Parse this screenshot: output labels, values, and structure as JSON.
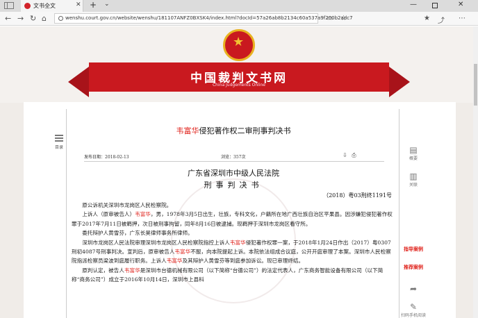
{
  "browser": {
    "tab_title": "文书全文",
    "tab_close": "✕",
    "new_tab": "+",
    "tab_menu": "⌄",
    "minimize": "—",
    "close": "✕",
    "url": "wenshu.court.gov.cn/website/wenshu/181107ANFZ0BXSK4/index.html?docId=57a26ab8b2134c60a537a9f200b2adc7",
    "back": "←",
    "forward": "→",
    "refresh": "↻",
    "home": "⌂",
    "icons": [
      "reading-mode-icon",
      "favorite-icon",
      "favorites-list-icon",
      "share-icon"
    ]
  },
  "site": {
    "title": "中国裁判文书网",
    "subtitle": "China Judgements Online",
    "emblem_color": "#c9191f"
  },
  "toc": {
    "label": "目录"
  },
  "document": {
    "title_name": "韦富华",
    "title_rest": "侵犯著作权二审刑事判决书",
    "publish_label": "发布日期：2018-02-13",
    "views_label": "浏览：357次",
    "court": "广东省深圳市中级人民法院",
    "doc_type": "刑事判决书",
    "case_no": "（2018）粤03刑终1191号",
    "paragraphs": [
      [
        {
          "t": "原公诉机关深圳市龙岗区人民检察院。"
        }
      ],
      [
        {
          "t": "上诉人（原审被告人）"
        },
        {
          "t": "韦富华",
          "red": true
        },
        {
          "t": "，男，1978年3月5日出生，壮族，专科文化，户籍所在地广西壮族自治区平果县。因涉嫌犯侵犯著作权罪于2017年7月11日被羁押，次日被刑事拘留，同年8月16日被逮捕。现羁押于深圳市龙岗区看守所。"
        }
      ],
      [
        {
          "t": "委托辩护人黄雪芬，广东长昊律师事务所律师。"
        }
      ],
      [
        {
          "t": "深圳市龙岗区人民法院审理深圳市龙岗区人民检察院指控上诉人"
        },
        {
          "t": "韦富华",
          "red": true
        },
        {
          "t": "侵犯著作权罪一案，于2018年1月24日作出（2017）粤0307刑初4087号刑事判决。宣判后，原审被告人"
        },
        {
          "t": "韦富华",
          "red": true
        },
        {
          "t": "不服，向本院提起上诉。本院依法组成合议庭，公开开庭审理了本案。深圳市人民检察院指派检察员梁波到庭履行职务。上诉人"
        },
        {
          "t": "韦富华",
          "red": true
        },
        {
          "t": "及其辩护人黄雪芬等到庭参加诉讼。现已审理终结。"
        }
      ],
      [
        {
          "t": "原判认定，被告人"
        },
        {
          "t": "韦富华",
          "red": true
        },
        {
          "t": "是深圳市台德机械有限公司（以下简称“台德公司”）的法定代表人，广东商务智能设备有限公司（以下简称“商务公司”）成立于2016年10月14日，深圳市上县科"
        }
      ]
    ]
  },
  "side_tools": {
    "summary_label": "概要",
    "related_label": "关联",
    "guide_label": "指导案例",
    "recommend_label": "推荐案例",
    "feedback_label": "扫码手机阅读"
  }
}
